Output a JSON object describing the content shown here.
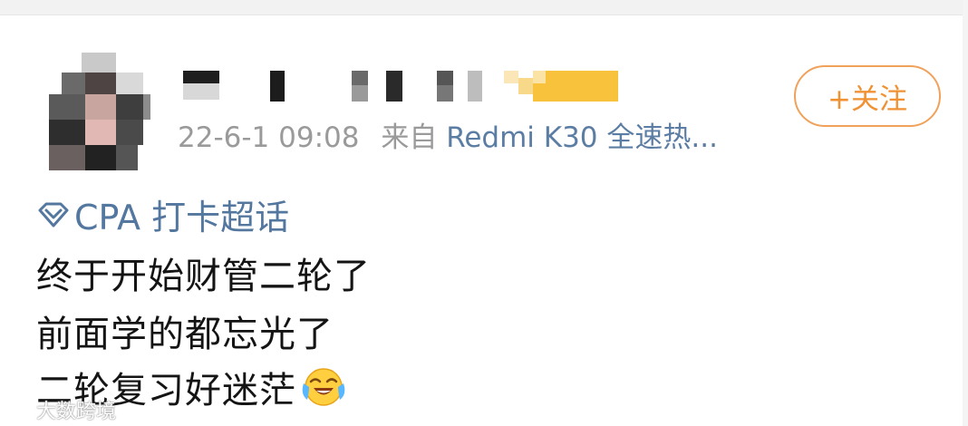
{
  "post": {
    "timestamp": "22-6-1 09:08",
    "source_prefix": "来自",
    "source_device": "Redmi K30 全速热...",
    "follow_label": "+关注",
    "topic_label": "CPA 打卡超话",
    "content_lines": [
      "终于开始财管二轮了",
      "前面学的都忘光了",
      "二轮复习好迷茫"
    ],
    "emoji": "laugh-cry-emoji"
  },
  "watermark": {
    "text": "大数跨境",
    "icon": "weibo-logo-icon"
  },
  "colors": {
    "follow_orange": "#f09234",
    "link_blue": "#53779f",
    "meta_gray": "#9a9a9a",
    "text_black": "#141414"
  }
}
